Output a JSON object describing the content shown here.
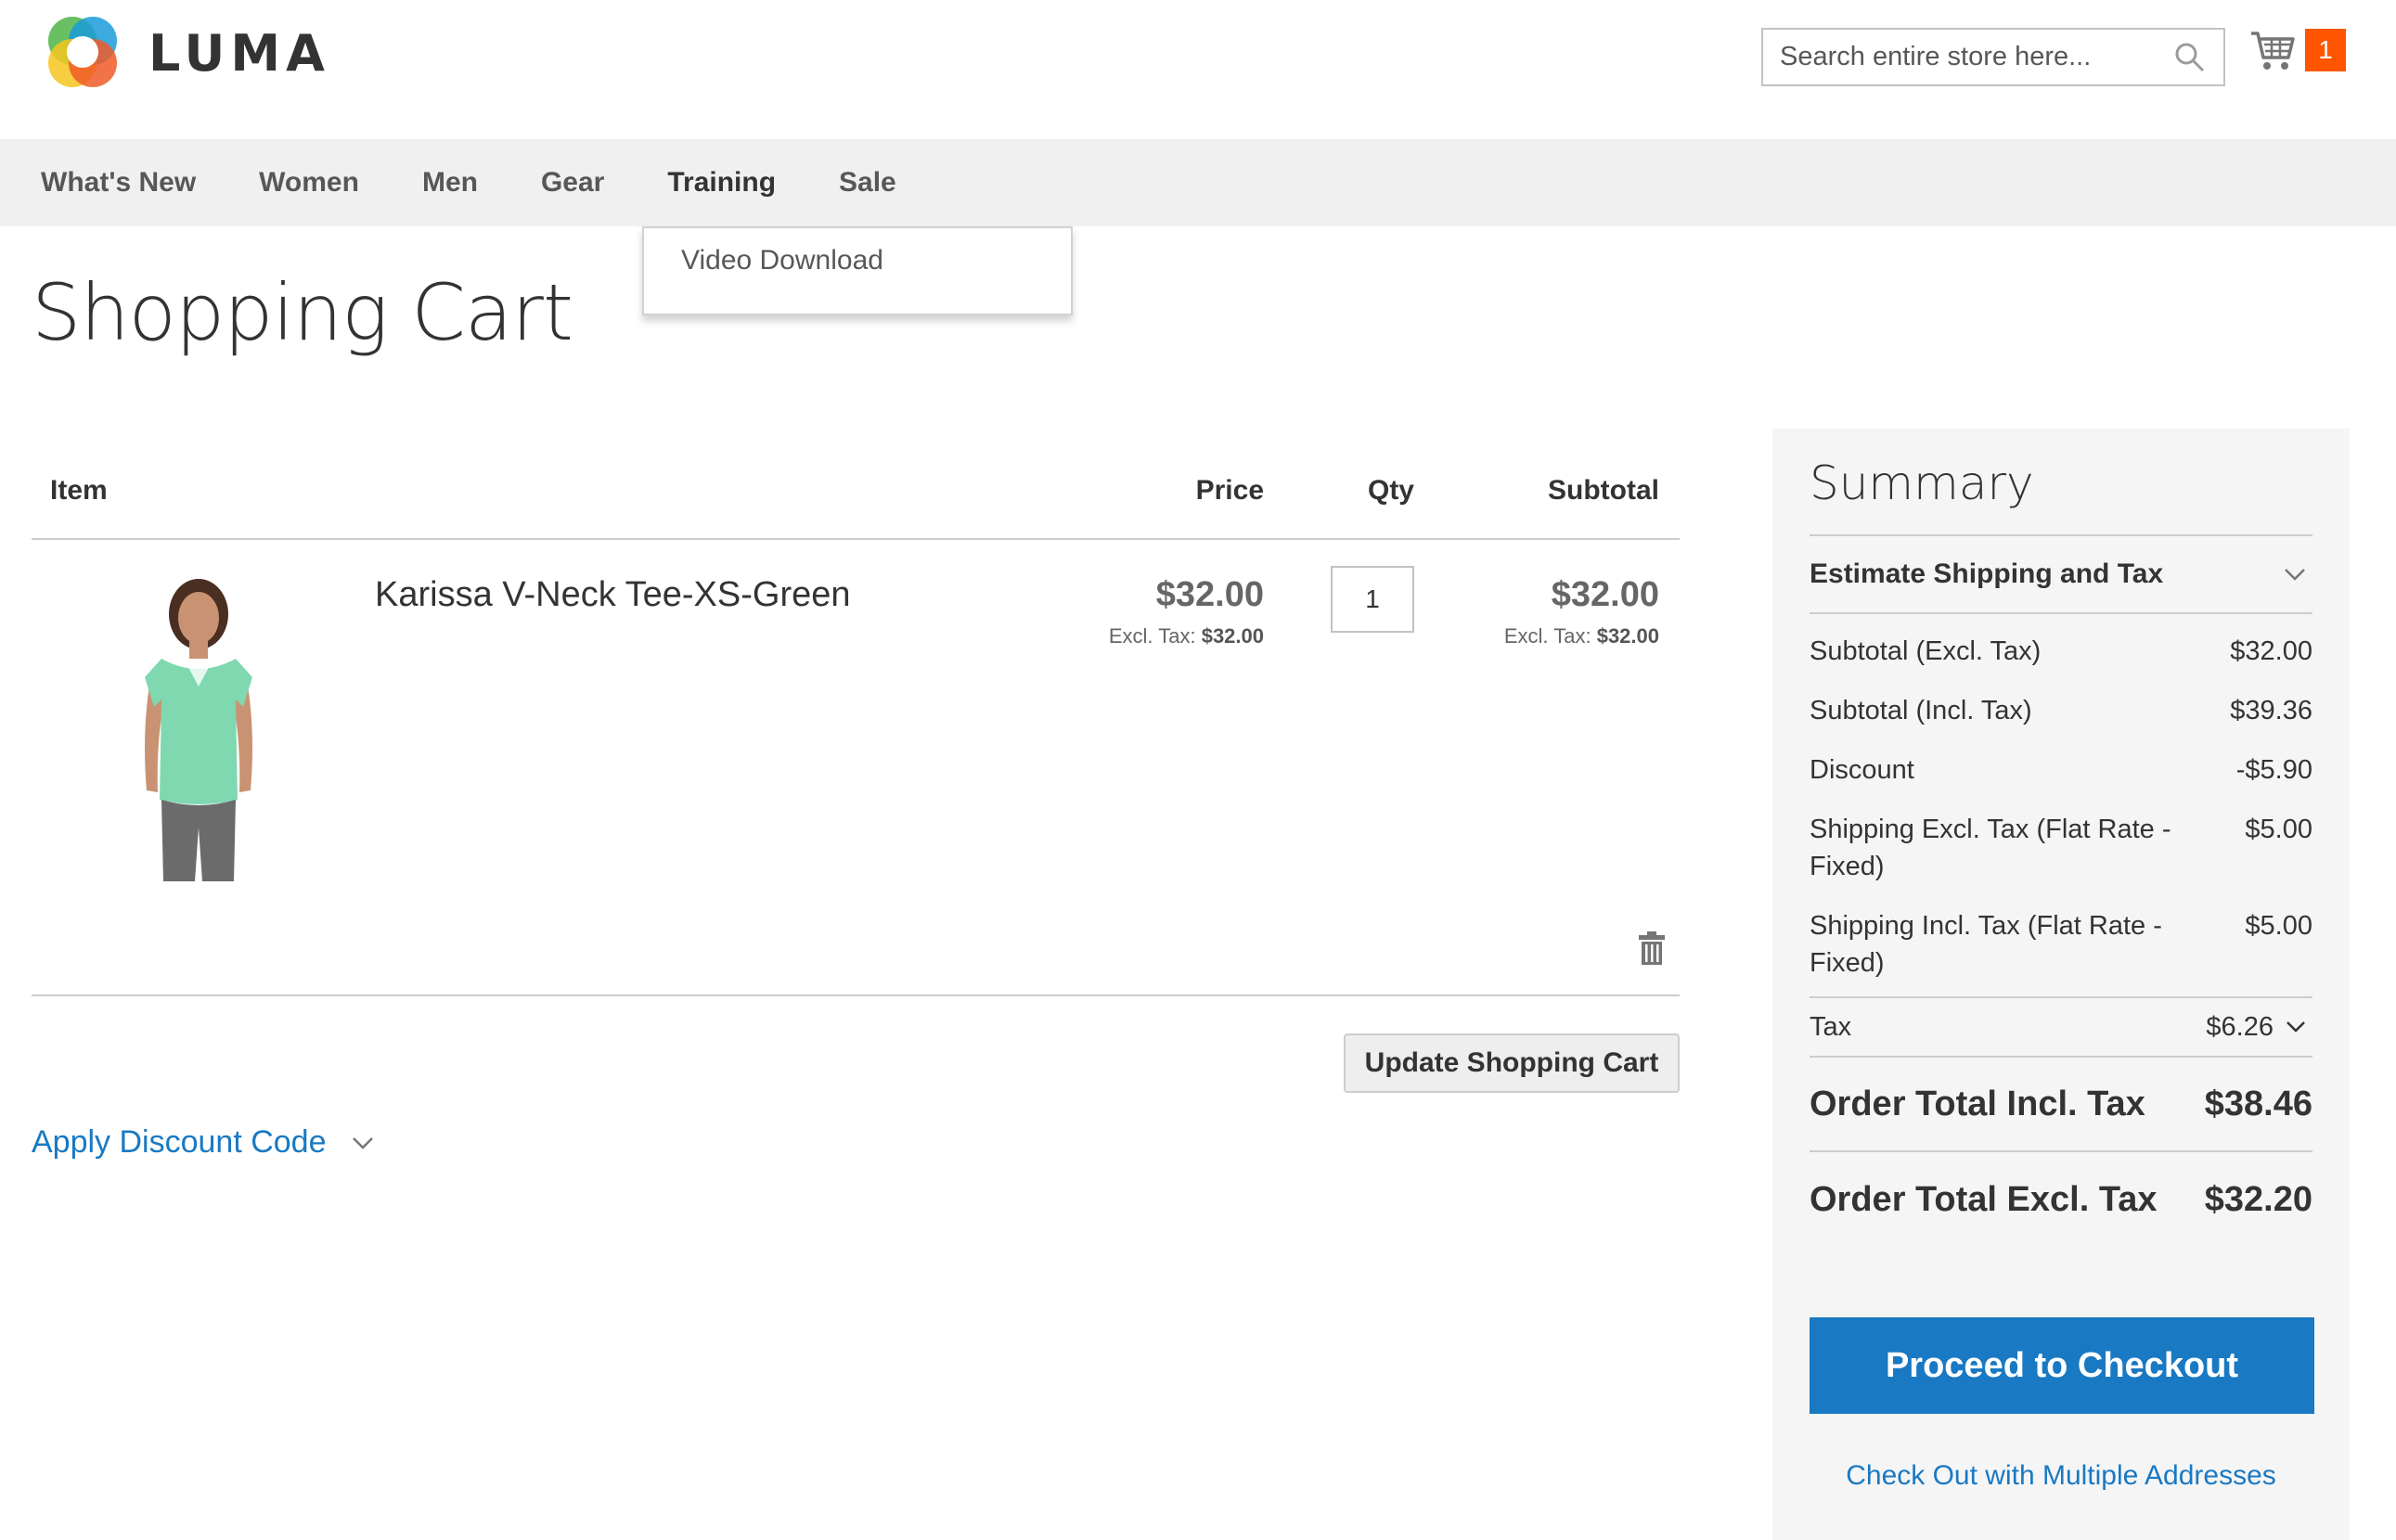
{
  "header": {
    "logo_text": "LUMA",
    "search_placeholder": "Search entire store here...",
    "cart_count": "1"
  },
  "nav": {
    "items": [
      "What's New",
      "Women",
      "Men",
      "Gear",
      "Training",
      "Sale"
    ],
    "active": "Training",
    "submenu": [
      "Video Download"
    ]
  },
  "page": {
    "title": "Shopping Cart"
  },
  "cart": {
    "columns": {
      "item": "Item",
      "price": "Price",
      "qty": "Qty",
      "subtotal": "Subtotal"
    },
    "items": [
      {
        "name": "Karissa V-Neck Tee-XS-Green",
        "price": "$32.00",
        "price_excl_label": "Excl. Tax:",
        "price_excl": "$32.00",
        "qty": "1",
        "subtotal": "$32.00",
        "subtotal_excl_label": "Excl. Tax:",
        "subtotal_excl": "$32.00"
      }
    ],
    "update_label": "Update Shopping Cart",
    "discount_label": "Apply Discount Code"
  },
  "summary": {
    "title": "Summary",
    "estimate_label": "Estimate Shipping and Tax",
    "rows": [
      {
        "label": "Subtotal (Excl. Tax)",
        "value": "$32.00"
      },
      {
        "label": "Subtotal (Incl. Tax)",
        "value": "$39.36"
      },
      {
        "label": "Discount",
        "value": "-$5.90"
      },
      {
        "label": "Shipping Excl. Tax (Flat Rate - Fixed)",
        "value": "$5.00"
      },
      {
        "label": "Shipping Incl. Tax (Flat Rate - Fixed)",
        "value": "$5.00"
      }
    ],
    "tax_label": "Tax",
    "tax_value": "$6.26",
    "grand_incl_label": "Order Total Incl. Tax",
    "grand_incl_value": "$38.46",
    "grand_excl_label": "Order Total Excl. Tax",
    "grand_excl_value": "$32.20",
    "checkout_label": "Proceed to Checkout",
    "multi_label": "Check Out with Multiple Addresses"
  },
  "colors": {
    "accent": "#1979c3",
    "cart_badge": "#ff5501",
    "nav_bg": "#f0f0f0",
    "summary_bg": "#f5f5f5"
  },
  "icons": [
    "luma-logo-icon",
    "search-icon",
    "cart-icon",
    "trash-icon",
    "chevron-down-icon"
  ]
}
